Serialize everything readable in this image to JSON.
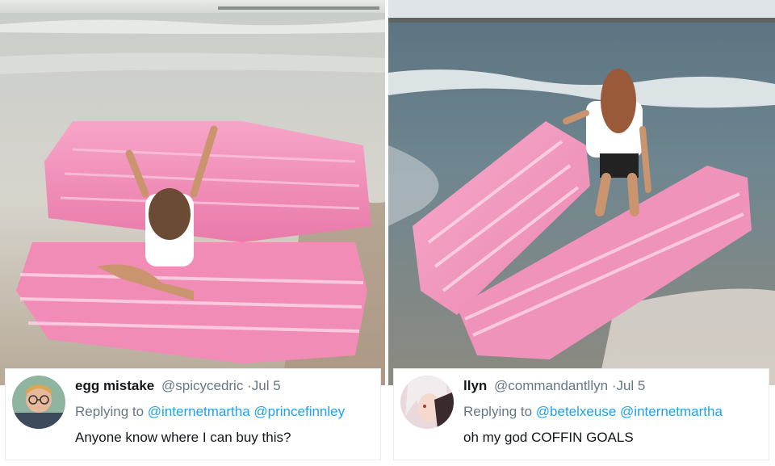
{
  "tweets": [
    {
      "name": "egg mistake",
      "handle": "@spicycedric",
      "time": "·Jul 5",
      "replying_to_label": "Replying to",
      "mentions": [
        "@internetmartha",
        "@princefinnley"
      ],
      "text": "Anyone know where I can buy this?"
    },
    {
      "name": "llyn",
      "handle": "@commandantllyn",
      "time": "·Jul 5",
      "replying_to_label": "Replying to",
      "mentions": [
        "@betelxeuse",
        "@internetmartha"
      ],
      "text": "oh my god COFFIN GOALS"
    }
  ],
  "colors": {
    "mention": "#1da1f2",
    "handle": "#657786",
    "coffin_pink": "#f48fb8",
    "sea": "#7a8f96",
    "sand": "#b8a591"
  },
  "icons": [
    "avatar-glasses-person",
    "avatar-anime-character"
  ]
}
